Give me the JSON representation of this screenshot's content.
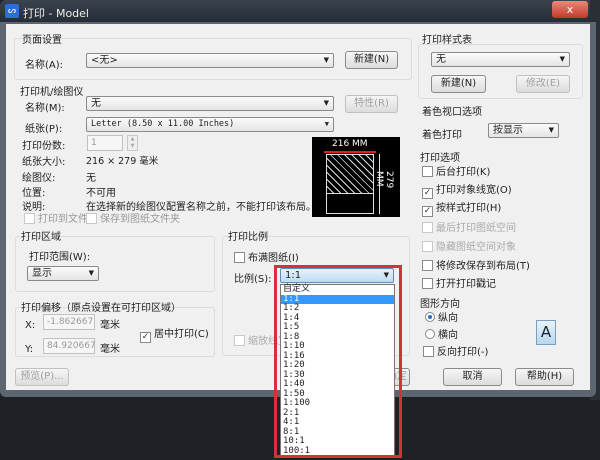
{
  "window": {
    "title": "打印 - Model",
    "close": "x"
  },
  "page_setup": {
    "group": "页面设置",
    "name_label": "名称(A):",
    "name_value": "<无>",
    "new_button": "新建(N)"
  },
  "printer": {
    "group": "打印机/绘图仪",
    "name_label": "名称(M):",
    "name_value": "无",
    "properties_button": "特性(R)",
    "paper_label": "纸张(P):",
    "paper_value": "Letter (8.50 x 11.00 Inches)",
    "copies_label": "打印份数:",
    "copies_value": "1",
    "paper_size_label": "纸张大小:",
    "paper_size_value": "216 × 279  毫米",
    "plotter_label": "绘图仪:",
    "plotter_value": "无",
    "location_label": "位置:",
    "location_value": "不可用",
    "description_label": "说明:",
    "description_value": "在选择新的绘图仪配置名称之前，不能打印该布局。",
    "print_to_file": "打印到文件",
    "save_to_folder": "保存到图纸文件夹",
    "preview_width": "216 MM",
    "preview_height": "279 MM"
  },
  "plot_area": {
    "group": "打印区域",
    "range_label": "打印范围(W):",
    "range_value": "显示"
  },
  "plot_offset": {
    "group": "打印偏移（原点设置在可打印区域）",
    "x_label": "X:",
    "x_value": "-1.862667",
    "y_label": "Y:",
    "y_value": "84.920667",
    "unit": "毫米",
    "center_label": "居中打印(C)",
    "center_checked": true
  },
  "plot_scale": {
    "group": "打印比例",
    "fit_paper": "布满图纸(I)",
    "fit_checked": false,
    "scale_label": "比例(S):",
    "scale_value": "1:1",
    "scale_lineweights": "缩放线宽",
    "options": [
      "自定义",
      "1:1",
      "1:2",
      "1:4",
      "1:5",
      "1:8",
      "1:10",
      "1:16",
      "1:20",
      "1:30",
      "1:40",
      "1:50",
      "1:100",
      "2:1",
      "4:1",
      "8:1",
      "10:1",
      "100:1"
    ],
    "highlight_color": "#3399ff",
    "annotation_color": "#d6303a"
  },
  "style_table": {
    "group": "打印样式表",
    "value": "无",
    "new_button": "新建(N)",
    "edit_button": "修改(E)"
  },
  "shaded": {
    "group": "着色视口选项",
    "label": "着色打印",
    "value": "按显示"
  },
  "options": {
    "group": "打印选项",
    "items": [
      {
        "label": "后台打印(K)",
        "checked": false,
        "disabled": false
      },
      {
        "label": "打印对象线宽(O)",
        "checked": true,
        "disabled": false
      },
      {
        "label": "按样式打印(H)",
        "checked": true,
        "disabled": false
      },
      {
        "label": "最后打印图纸空间",
        "checked": false,
        "disabled": true
      },
      {
        "label": "隐藏图纸空间对象",
        "checked": false,
        "disabled": true
      },
      {
        "label": "将修改保存到布局(T)",
        "checked": false,
        "disabled": false
      },
      {
        "label": "打开打印戳记",
        "checked": false,
        "disabled": false
      }
    ]
  },
  "orientation": {
    "group": "图形方向",
    "portrait": "纵向",
    "landscape": "横向",
    "reverse": "反向打印(-)",
    "selected": "portrait",
    "icon_letter": "A"
  },
  "buttons": {
    "preview": "预览(P)...",
    "ok": "确定",
    "cancel": "取消",
    "help": "帮助(H)"
  }
}
